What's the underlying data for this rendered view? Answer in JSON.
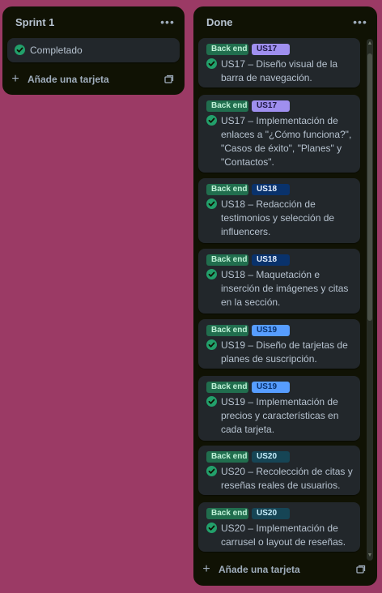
{
  "colors": {
    "background": "#9b3a65",
    "list_bg": "#101204",
    "card_bg": "#22272b",
    "check": "#22a06b",
    "label_backend": "#216e4e"
  },
  "lists": [
    {
      "title": "Sprint 1",
      "menu_icon": "ellipsis-icon",
      "cards": [
        {
          "text": "Completado"
        }
      ],
      "add_label": "Añade una tarjeta"
    },
    {
      "title": "Done",
      "menu_icon": "ellipsis-icon",
      "add_label": "Añade una tarjeta",
      "cards": [
        {
          "labels": [
            {
              "text": "Back end",
              "color": "#216e4e",
              "fg": "#bef0d6"
            },
            {
              "text": "US17",
              "color": "#9f8fef",
              "fg": "#1f1944"
            }
          ],
          "text": "US17 – Diseño visual de la barra de navegación."
        },
        {
          "labels": [
            {
              "text": "Back end",
              "color": "#216e4e",
              "fg": "#bef0d6"
            },
            {
              "text": "US17",
              "color": "#9f8fef",
              "fg": "#1f1944"
            }
          ],
          "text": "US17 – Implementación de enlaces a \"¿Cómo funciona?\", \"Casos de éxito\", \"Planes\" y \"Contactos\"."
        },
        {
          "labels": [
            {
              "text": "Back end",
              "color": "#216e4e",
              "fg": "#bef0d6"
            },
            {
              "text": "US18",
              "color": "#09326c",
              "fg": "#e9f2ff"
            }
          ],
          "text": "US18 – Redacción de testimonios y selección de influencers."
        },
        {
          "labels": [
            {
              "text": "Back end",
              "color": "#216e4e",
              "fg": "#bef0d6"
            },
            {
              "text": "US18",
              "color": "#09326c",
              "fg": "#e9f2ff"
            }
          ],
          "text": "US18 – Maquetación e inserción de imágenes y citas en la sección."
        },
        {
          "labels": [
            {
              "text": "Back end",
              "color": "#216e4e",
              "fg": "#bef0d6"
            },
            {
              "text": "US19",
              "color": "#579dff",
              "fg": "#09326c"
            }
          ],
          "text": "US19 – Diseño de tarjetas de planes de suscripción."
        },
        {
          "labels": [
            {
              "text": "Back end",
              "color": "#216e4e",
              "fg": "#bef0d6"
            },
            {
              "text": "US19",
              "color": "#579dff",
              "fg": "#09326c"
            }
          ],
          "text": "US19 – Implementación de precios y características en cada tarjeta."
        },
        {
          "labels": [
            {
              "text": "Back end",
              "color": "#216e4e",
              "fg": "#bef0d6"
            },
            {
              "text": "US20",
              "color": "#164555",
              "fg": "#c6edfb"
            }
          ],
          "text": "US20 – Recolección de citas y reseñas reales de usuarios."
        },
        {
          "labels": [
            {
              "text": "Back end",
              "color": "#216e4e",
              "fg": "#bef0d6"
            },
            {
              "text": "US20",
              "color": "#164555",
              "fg": "#c6edfb"
            }
          ],
          "text": "US20 – Implementación de carrusel o layout de reseñas."
        }
      ]
    }
  ]
}
